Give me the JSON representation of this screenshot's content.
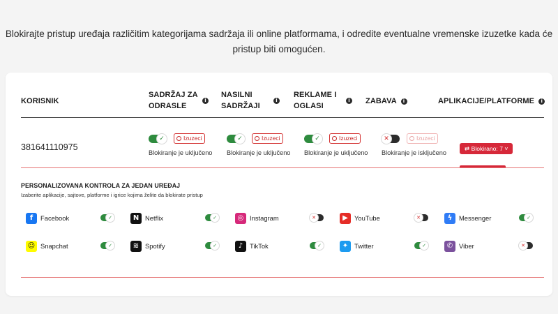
{
  "intro": {
    "line1": "Blokirajte pristup uređaja različitim kategorijama sadržaja ili online platformama, i odredite eventualne vremenske izuzetke kada će",
    "line2": "pristup biti omogućen."
  },
  "table": {
    "headers": {
      "user": "KORISNIK",
      "adult_l1": "SADRŽAJ ZA",
      "adult_l2": "ODRASLE",
      "violent_l1": "NASILNI",
      "violent_l2": "SADRŽAJI",
      "ads_l1": "REKLAME I",
      "ads_l2": "OGLASI",
      "fun": "ZABAVA",
      "apps": "APLIKACIJE/PLATFORME"
    },
    "info_glyph": "i",
    "row": {
      "user": "381641110975",
      "categories": [
        {
          "enabled": true,
          "exceptions": "Izuzeci",
          "status": "Blokiranje je uključeno"
        },
        {
          "enabled": true,
          "exceptions": "Izuzeci",
          "status": "Blokiranje je uključeno"
        },
        {
          "enabled": true,
          "exceptions": "Izuzeci",
          "status": "Blokiranje je uključeno"
        },
        {
          "enabled": false,
          "exceptions": "Izuzeci",
          "status": "Blokiranje je isključeno"
        }
      ],
      "blocked_button": "⇄ Blokirano: 7 ˅"
    }
  },
  "personal": {
    "title": "PERSONALIZOVANA KONTROLA ZA JEDAN UREĐAJ",
    "subtitle": "Izaberite aplikacije, sajtove, platforme i igrice kojima želite da blokirate pristup",
    "apps": [
      {
        "name": "Facebook",
        "icon": "facebook-icon",
        "glyph": "f",
        "color": "#1877f2",
        "enabled": true
      },
      {
        "name": "Netflix",
        "icon": "netflix-icon",
        "glyph": "N",
        "color": "#111111",
        "enabled": true
      },
      {
        "name": "Instagram",
        "icon": "instagram-icon",
        "glyph": "◎",
        "color": "#d6297a",
        "enabled": false
      },
      {
        "name": "YouTube",
        "icon": "youtube-icon",
        "glyph": "▶",
        "color": "#e52d27",
        "enabled": false
      },
      {
        "name": "Messenger",
        "icon": "messenger-icon",
        "glyph": "ϟ",
        "color": "#2f7cf6",
        "enabled": true
      },
      {
        "name": "Snapchat",
        "icon": "snapchat-icon",
        "glyph": "☺",
        "color": "#fffc00",
        "enabled": true
      },
      {
        "name": "Spotify",
        "icon": "spotify-icon",
        "glyph": "≋",
        "color": "#111111",
        "enabled": true
      },
      {
        "name": "TikTok",
        "icon": "tiktok-icon",
        "glyph": "♪",
        "color": "#111111",
        "enabled": true
      },
      {
        "name": "Twitter",
        "icon": "twitter-icon",
        "glyph": "✦",
        "color": "#1d9bf0",
        "enabled": true
      },
      {
        "name": "Viber",
        "icon": "viber-icon",
        "glyph": "✆",
        "color": "#7b519d",
        "enabled": false
      }
    ]
  },
  "colors": {
    "accent_red": "#d62839",
    "toggle_on": "#2e8b3e",
    "toggle_off": "#2c2c2c"
  }
}
